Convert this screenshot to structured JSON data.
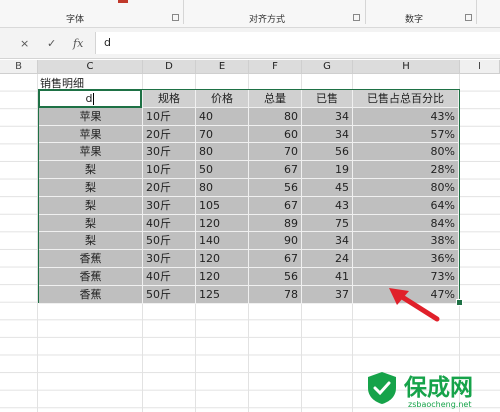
{
  "ribbon": {
    "groups": [
      {
        "label": "字体"
      },
      {
        "label": "对齐方式"
      },
      {
        "label": "数字"
      }
    ]
  },
  "formula_bar": {
    "cancel": "×",
    "confirm": "✓",
    "fx": "fx",
    "value": "d"
  },
  "columns": [
    "B",
    "C",
    "D",
    "E",
    "F",
    "G",
    "H",
    "I"
  ],
  "sheet": {
    "title": "销售明细",
    "active_cell_value": "d",
    "headers": [
      "d",
      "规格",
      "价格",
      "总量",
      "已售",
      "已售占总百分比"
    ],
    "rows": [
      {
        "name": "苹果",
        "spec": "10斤",
        "price": "40",
        "total": "80",
        "sold": "34",
        "pct": "43%"
      },
      {
        "name": "苹果",
        "spec": "20斤",
        "price": "70",
        "total": "60",
        "sold": "34",
        "pct": "57%"
      },
      {
        "name": "苹果",
        "spec": "30斤",
        "price": "80",
        "total": "70",
        "sold": "56",
        "pct": "80%"
      },
      {
        "name": "梨",
        "spec": "10斤",
        "price": "50",
        "total": "67",
        "sold": "19",
        "pct": "28%"
      },
      {
        "name": "梨",
        "spec": "20斤",
        "price": "80",
        "total": "56",
        "sold": "45",
        "pct": "80%"
      },
      {
        "name": "梨",
        "spec": "30斤",
        "price": "105",
        "total": "67",
        "sold": "43",
        "pct": "64%"
      },
      {
        "name": "梨",
        "spec": "40斤",
        "price": "120",
        "total": "89",
        "sold": "75",
        "pct": "84%"
      },
      {
        "name": "梨",
        "spec": "50斤",
        "price": "140",
        "total": "90",
        "sold": "34",
        "pct": "38%"
      },
      {
        "name": "香蕉",
        "spec": "30斤",
        "price": "120",
        "total": "67",
        "sold": "24",
        "pct": "36%"
      },
      {
        "name": "香蕉",
        "spec": "40斤",
        "price": "120",
        "total": "56",
        "sold": "41",
        "pct": "73%"
      },
      {
        "name": "香蕉",
        "spec": "50斤",
        "price": "125",
        "total": "78",
        "sold": "37",
        "pct": "47%"
      }
    ]
  },
  "watermark": {
    "brand": "保成网",
    "url": "zsbaocheng.net"
  },
  "colors": {
    "selection_border": "#1e7145",
    "arrow": "#e0202a",
    "watermark": "#16a34a"
  }
}
